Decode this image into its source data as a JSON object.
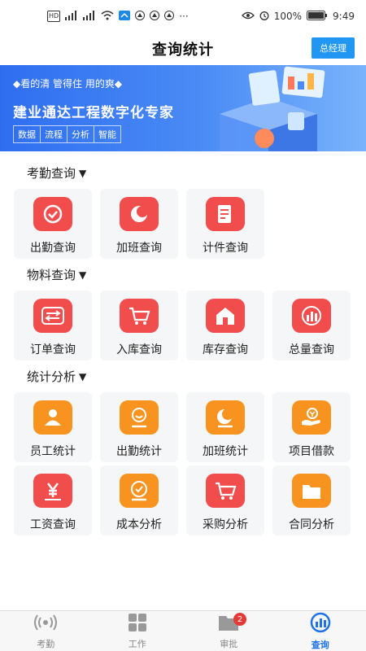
{
  "status_bar": {
    "left_icons": [
      "hd-icon",
      "signal-5g-icon",
      "signal-4g-icon",
      "wifi-icon",
      "app-notify-icon",
      "app-notify-icon",
      "app-notify-icon",
      "app-notify-icon"
    ],
    "left_text": "HD",
    "more": "···",
    "battery": "100%",
    "time": "9:49"
  },
  "header": {
    "title": "查询统计",
    "role_button": "总经理"
  },
  "banner": {
    "slogan": "◆看的清 管得住 用的爽◆",
    "headline": "建业通达工程数字化专家",
    "tags": [
      "数据",
      "流程",
      "分析",
      "智能"
    ]
  },
  "sections": [
    {
      "title": "考勤查询",
      "caret": "▼"
    },
    {
      "title": "物料查询",
      "caret": "▼"
    },
    {
      "title": "统计分析",
      "caret": "▼"
    }
  ],
  "attendance_tiles": [
    {
      "label": "出勤查询",
      "icon": "check-circle-icon",
      "color": "#f24d4d"
    },
    {
      "label": "加班查询",
      "icon": "moon-icon",
      "color": "#f24d4d"
    },
    {
      "label": "计件查询",
      "icon": "document-edit-icon",
      "color": "#f24d4d"
    }
  ],
  "material_tiles": [
    {
      "label": "订单查询",
      "icon": "transfer-arrows-icon",
      "color": "#f24d4d"
    },
    {
      "label": "入库查询",
      "icon": "cart-icon",
      "color": "#f24d4d"
    },
    {
      "label": "库存查询",
      "icon": "warehouse-icon",
      "color": "#f24d4d"
    },
    {
      "label": "总量查询",
      "icon": "bar-chart-icon",
      "color": "#f24d4d"
    }
  ],
  "stats_tiles": [
    {
      "label": "员工统计",
      "icon": "person-icon",
      "color": "#f7931e"
    },
    {
      "label": "出勤统计",
      "icon": "smile-person-icon",
      "color": "#f7931e"
    },
    {
      "label": "加班统计",
      "icon": "moon-icon",
      "color": "#f7931e"
    },
    {
      "label": "项目借款",
      "icon": "money-hand-icon",
      "color": "#f7931e"
    },
    {
      "label": "工资查询",
      "icon": "yen-icon",
      "color": "#f24d4d"
    },
    {
      "label": "成本分析",
      "icon": "check-circle-icon",
      "color": "#f7931e"
    },
    {
      "label": "采购分析",
      "icon": "cart-icon",
      "color": "#f24d4d"
    },
    {
      "label": "合同分析",
      "icon": "folder-icon",
      "color": "#f7931e"
    }
  ],
  "tabbar": {
    "items": [
      {
        "label": "考勤",
        "icon": "broadcast-icon",
        "active": false
      },
      {
        "label": "工作",
        "icon": "grid-icon",
        "active": false
      },
      {
        "label": "审批",
        "icon": "folder-icon",
        "active": false,
        "badge": "2"
      },
      {
        "label": "查询",
        "icon": "bar-chart-circle-icon",
        "active": true
      }
    ]
  },
  "colors": {
    "accent": "#2196f3",
    "red": "#f24d4d",
    "orange": "#f7931e",
    "tab_active": "#1e73e8"
  }
}
